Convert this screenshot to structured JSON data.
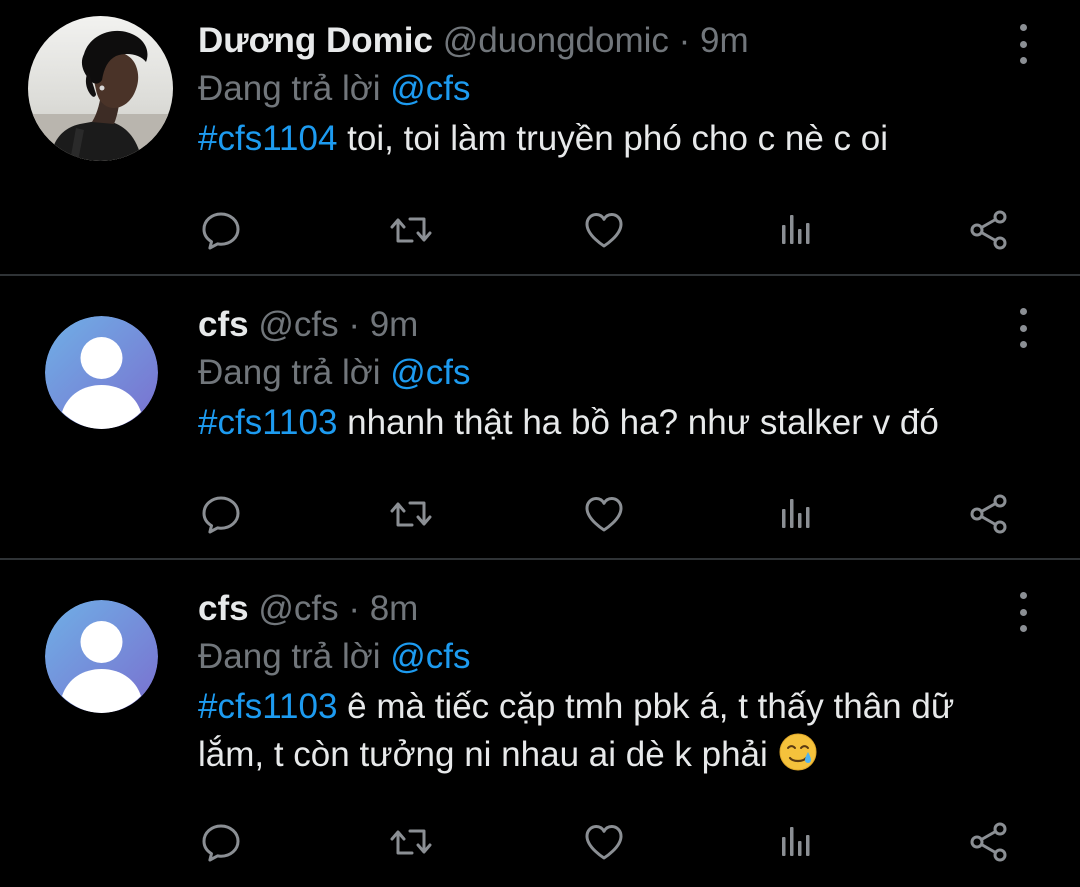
{
  "colors": {
    "background": "#000000",
    "divider": "#2f3336",
    "primary_text": "#e7e9ea",
    "secondary_text": "#71767b",
    "accent_blue": "#1d9bf0",
    "icon_gray": "#8b8f94"
  },
  "tweets": [
    {
      "display_name": "Dương Domic",
      "handle": "@duongdomic",
      "separator": "·",
      "time": "9m",
      "reply_prefix": "Đang trả lời",
      "reply_to": "@cfs",
      "hashtag": "#cfs1104",
      "text": " toi, toi làm truyền phó cho c nè c oi",
      "avatar_icon": "profile-photo",
      "more_icon": "more-vertical-icon"
    },
    {
      "display_name": "cfs",
      "handle": "@cfs",
      "separator": "·",
      "time": "9m",
      "reply_prefix": "Đang trả lời",
      "reply_to": "@cfs",
      "hashtag": "#cfs1103",
      "text": " nhanh thật ha bồ ha? như stalker v đó",
      "avatar_icon": "default-avatar-icon",
      "more_icon": "more-vertical-icon"
    },
    {
      "display_name": "cfs",
      "handle": "@cfs",
      "separator": "·",
      "time": "8m",
      "reply_prefix": "Đang trả lời",
      "reply_to": "@cfs",
      "hashtag": "#cfs1103",
      "text": " ê mà tiếc cặp tmh pbk á, t thấy thân dữ lắm, t còn tưởng ni nhau ai dè k phải ",
      "emoji_icon": "smiling-face-with-tear-emoji",
      "avatar_icon": "default-avatar-icon",
      "more_icon": "more-vertical-icon"
    }
  ],
  "action_icons": [
    "reply-icon",
    "retweet-icon",
    "like-icon",
    "analytics-icon",
    "share-icon"
  ]
}
